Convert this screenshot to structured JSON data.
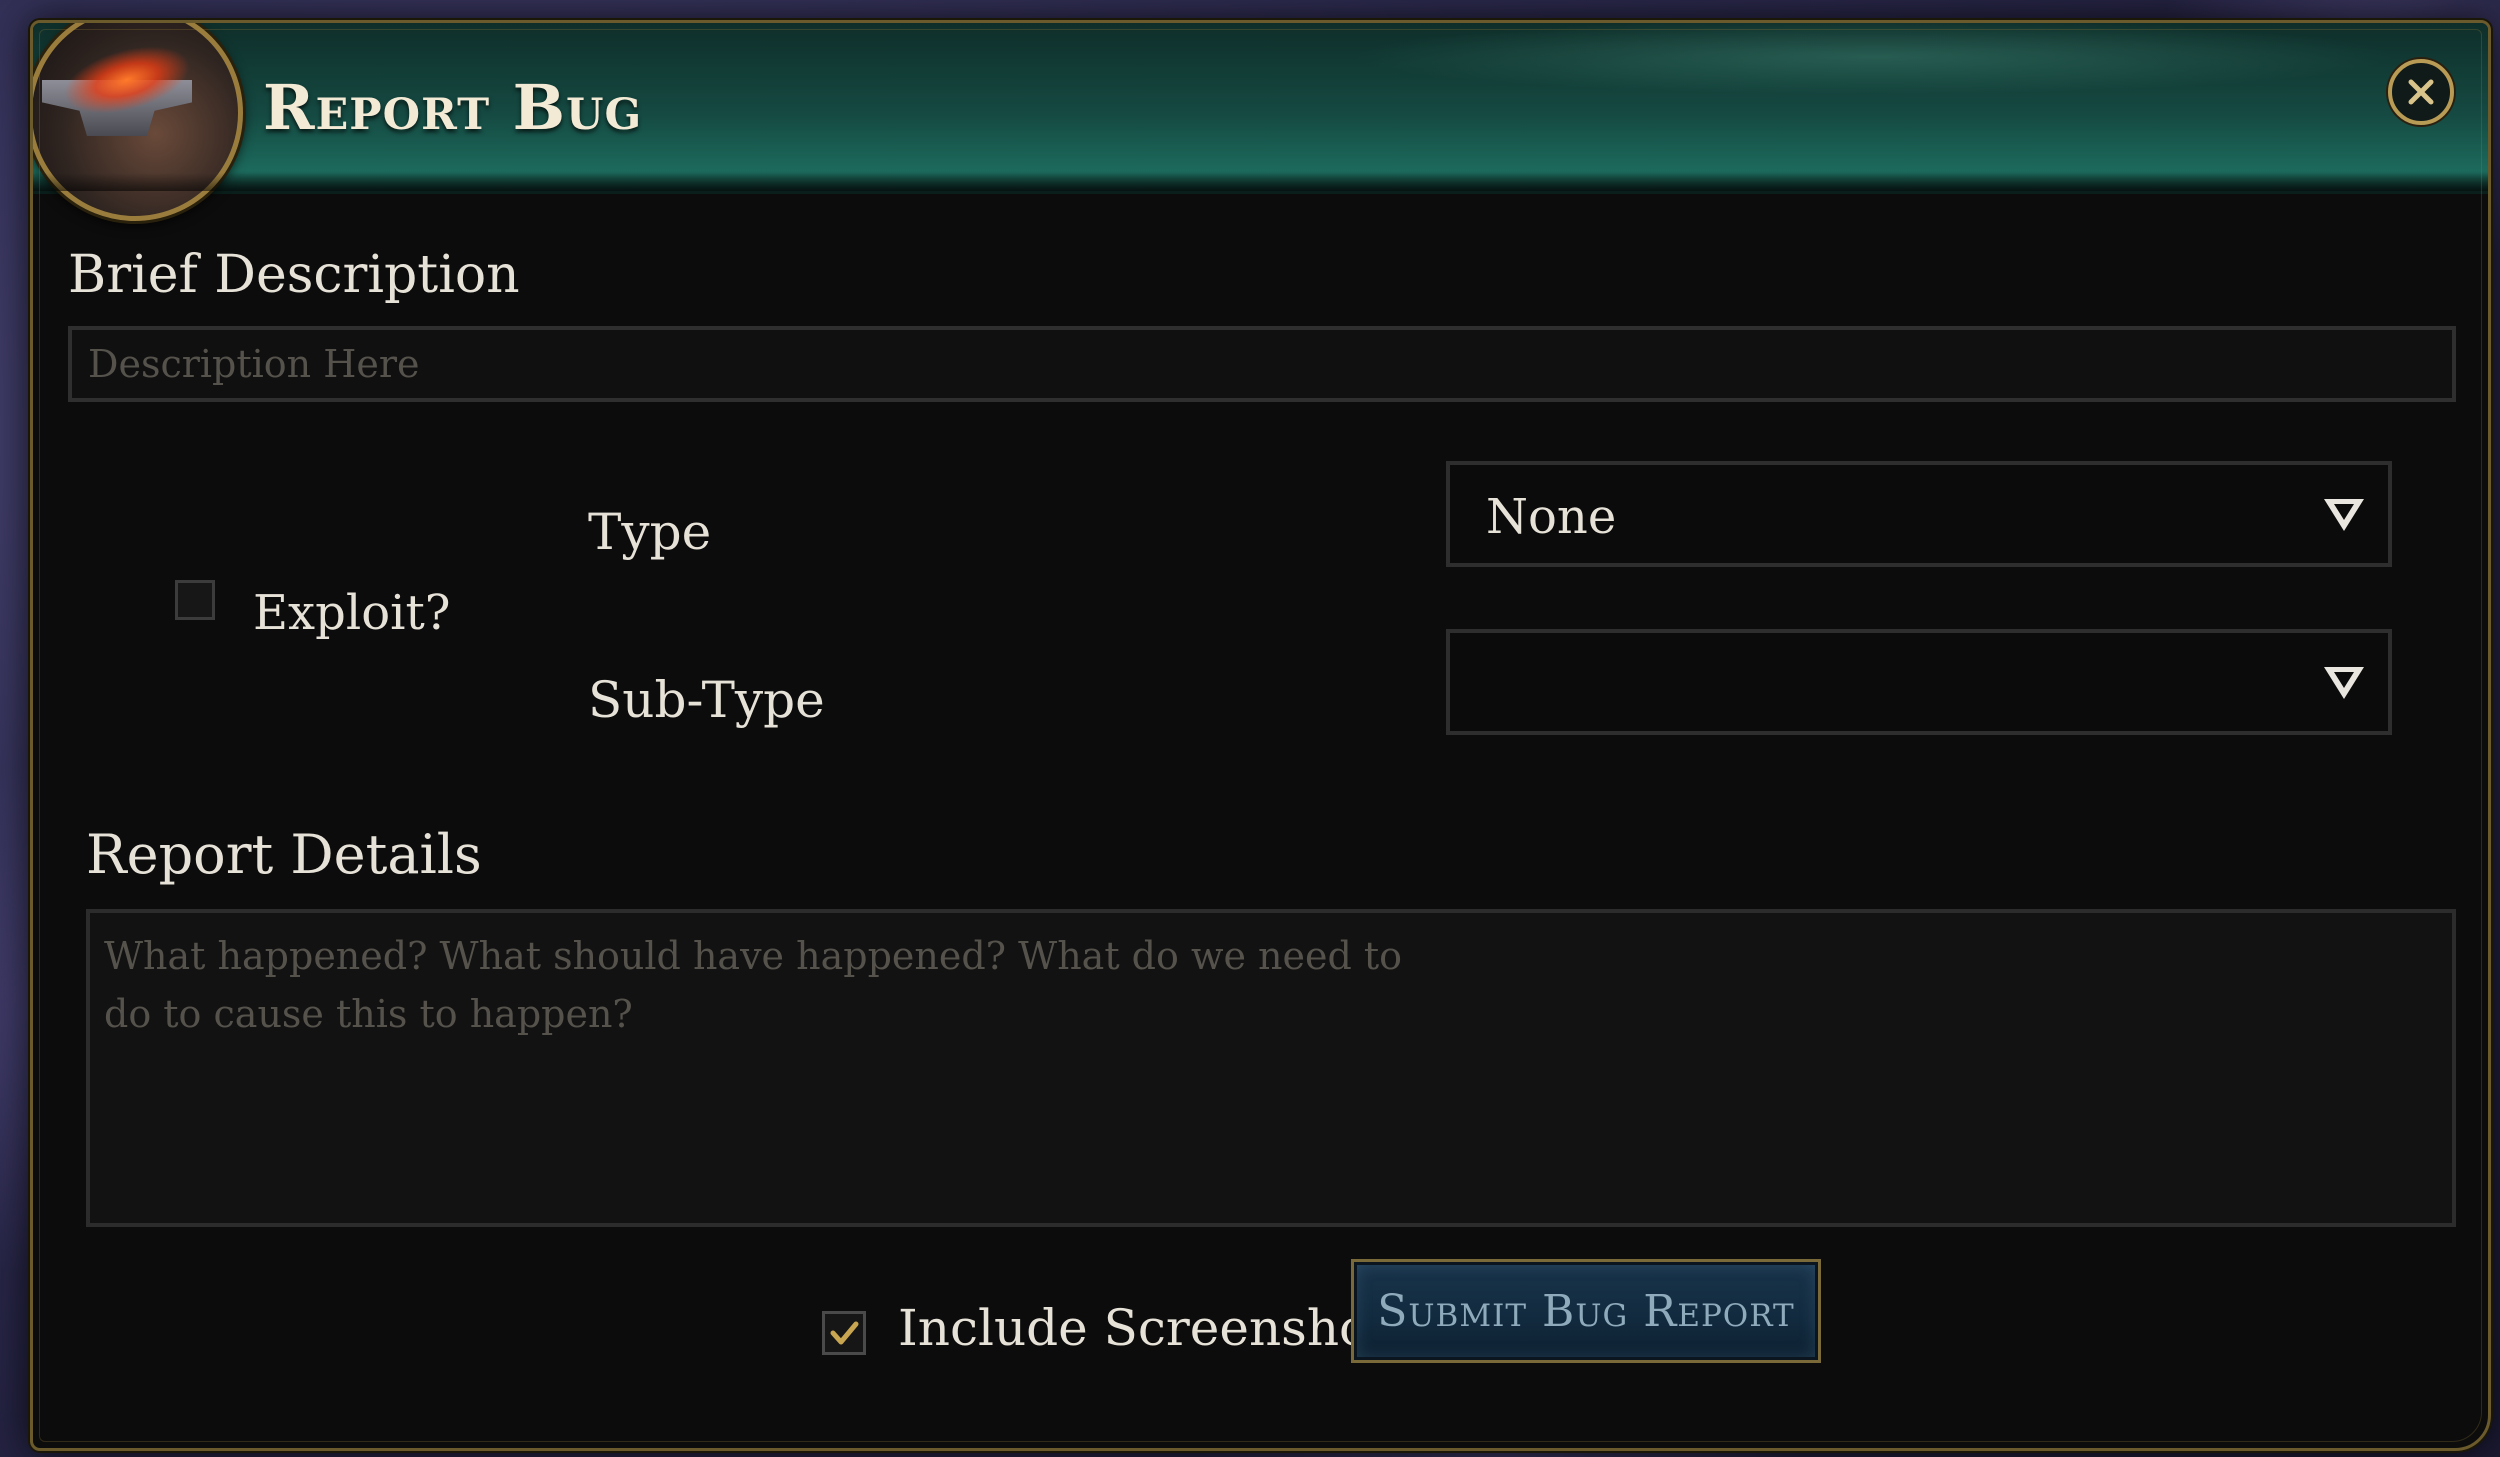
{
  "dialog": {
    "title": "Report Bug",
    "close_icon": "close-icon",
    "header_icon": "anvil-icon"
  },
  "brief": {
    "label": "Brief Description",
    "placeholder": "Description Here",
    "value": ""
  },
  "exploit": {
    "label": "Exploit?",
    "checked": false
  },
  "type": {
    "label": "Type",
    "selected": "None"
  },
  "subtype": {
    "label": "Sub-Type",
    "selected": ""
  },
  "details": {
    "label": "Report Details",
    "placeholder": "What happened? What should have happened? What do we need to\ndo to cause this to happen?",
    "value": ""
  },
  "screenshot": {
    "label": "Include Screenshot",
    "checked": true
  },
  "submit": {
    "label": "Submit Bug Report"
  },
  "colors": {
    "header_teal": "#1c6a5c",
    "gold_border": "#9a7d3d",
    "submit_bg": "#18334a",
    "submit_text": "#8eaabb",
    "check_mark": "#c8a550"
  }
}
